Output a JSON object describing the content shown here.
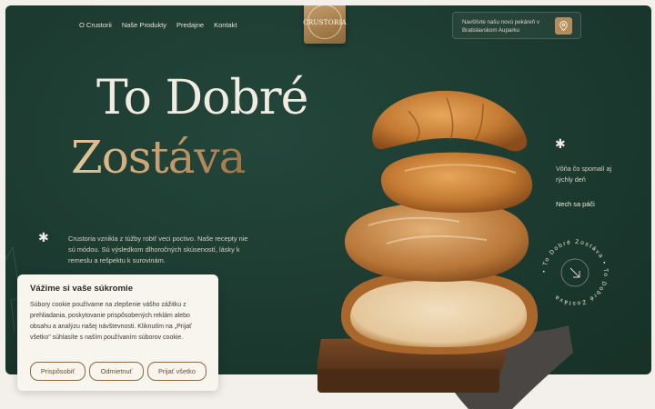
{
  "nav": {
    "items": [
      "O Crustorii",
      "Naše Produkty",
      "Predajne",
      "Kontakt"
    ]
  },
  "logo": {
    "text": "CRUSTORIA"
  },
  "notice": {
    "text": "Navštívte našu novú pekáreň v Bratislavskom Auparku",
    "icon": "location-pin-icon"
  },
  "hero": {
    "title_line1": "To Dobré",
    "title_line2": "Zostáva",
    "lead": "Crustoria vznikla z túžby robiť veci poctivo. Naše recepty nie sú módou. Sú výsledkom dlhoročných skúseností, lásky k remeslu a rešpektu k surovinám.",
    "side_text": "Vôňa čo spomalí aj rýchly deň",
    "side_link": "Nech sa páči",
    "badge_text": "• To Dobré Zostáva • To Dobré Zostáva "
  },
  "cookie": {
    "title": "Vážime si vaše súkromie",
    "body": "Súbory cookie používame na zlepšenie vášho zážitku z prehliadania, poskytovanie prispôsobených reklám alebo obsahu a analýzu našej návštevnosti. Kliknutím na „Prijať všetko\" súhlasíte s naším používaním súborov cookie.",
    "buttons": {
      "customize": "Prispôsobiť",
      "reject": "Odmietnuť",
      "accept": "Prijať všetko"
    }
  },
  "colors": {
    "hero_bg": "#1c3a30",
    "gold": "#c9a070",
    "cream": "#f1ece2",
    "button_border": "#8b6a43"
  }
}
